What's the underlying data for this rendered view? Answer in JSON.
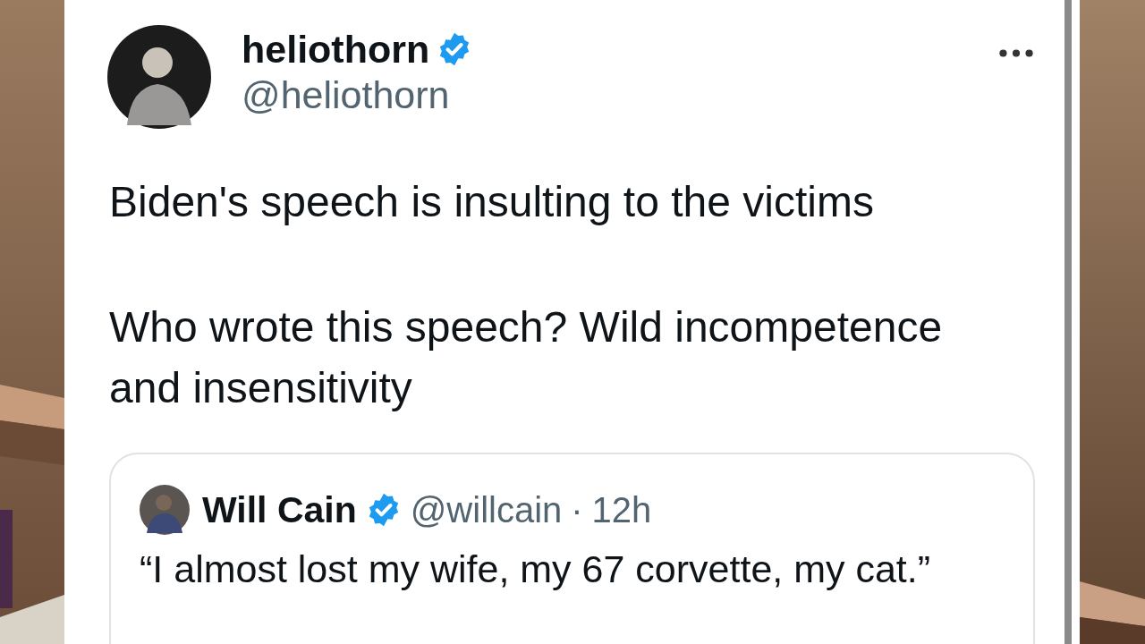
{
  "tweet": {
    "author": {
      "name": "heliothorn",
      "handle": "@heliothorn",
      "verified": true
    },
    "paragraphs": [
      "Biden's speech is insulting to the victims",
      "Who wrote this speech? Wild incompetence and insensitivity"
    ],
    "quote": {
      "author": {
        "name": "Will Cain",
        "handle": "@willcain",
        "verified": true
      },
      "separator": "·",
      "time": "12h",
      "text": "“I almost lost my wife, my 67 corvette, my cat.”"
    }
  }
}
